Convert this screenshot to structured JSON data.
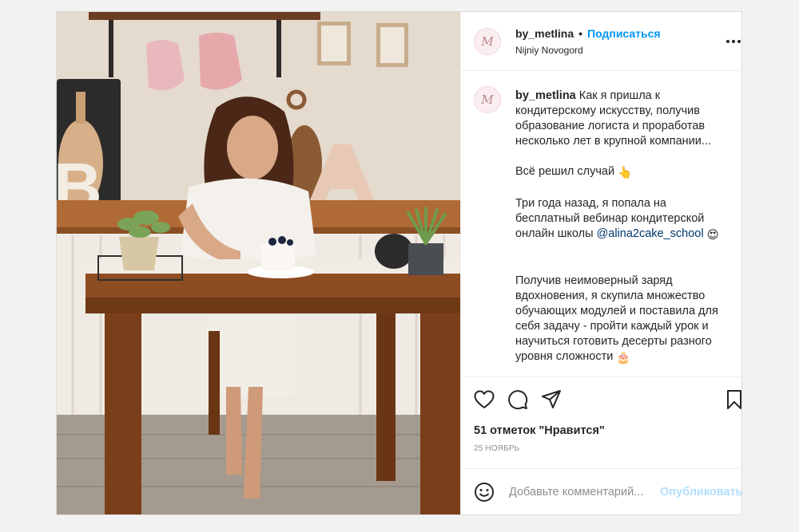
{
  "post": {
    "author": {
      "avatar_letter": "M",
      "username": "by_metlina",
      "follow_label": "Подписаться",
      "separator": "•",
      "location": "Nijniy Novogord"
    },
    "caption": {
      "username": "by_metlina",
      "paragraph_1": "Как я пришла к кондитерскому искусству, получив образование логиста и проработав несколько лет в крупной компании...",
      "paragraph_2": "Всё решил случай",
      "paragraph_2_emoji": "👆",
      "paragraph_3_text": "Три года назад, я попала на бесплатный вебинар кондитерской онлайн школы",
      "paragraph_3_mention": "@alina2cake_school",
      "paragraph_3_emoji": "😍",
      "paragraph_4": "Получив неимоверный заряд вдохновения, я скупила множество обучающих модулей и поставила для себя задачу - пройти каждый урок и научиться готовить десерты разного уровня сложности",
      "paragraph_4_emoji": "🎂"
    },
    "likes_text": "51 отметок \"Нравится\"",
    "date_text": "25 НОЯБРЬ",
    "comment": {
      "placeholder": "Добавьте комментарий...",
      "publish_label": "Опубликовать"
    },
    "icons": {
      "more": "more-options-icon",
      "like": "heart-icon",
      "comment": "comment-bubble-icon",
      "share": "paper-plane-icon",
      "save": "bookmark-icon",
      "emoji": "smiley-icon"
    }
  },
  "colors": {
    "accent": "#0095f6",
    "publish_disabled": "#b2dffc",
    "text": "#262626",
    "muted": "#8e8e8e",
    "border": "#dbdbdb"
  }
}
